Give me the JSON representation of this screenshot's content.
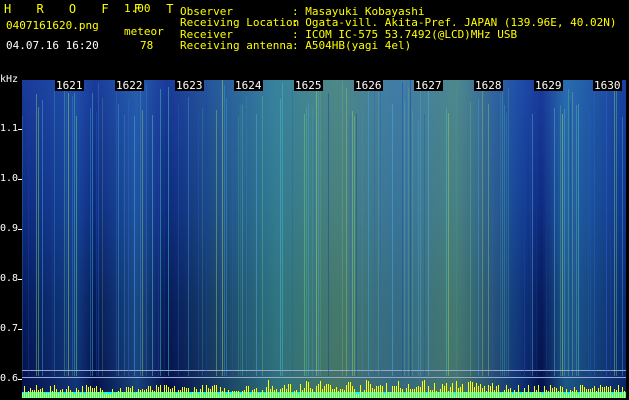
{
  "header": {
    "app_title": "H R O F F T",
    "app_version": "1.00",
    "filename": "0407161620.png",
    "meteor_label": "meteor",
    "datetime": "04.07.16 16:20",
    "meteor_count": "78"
  },
  "info": [
    {
      "label": "Observer",
      "value": ": Masayuki Kobayashi"
    },
    {
      "label": "Receiving Location",
      "value": ": Ogata-vill. Akita-Pref. JAPAN (139.96E, 40.02N)"
    },
    {
      "label": "Receiver",
      "value": ": ICOM IC-575 53.7492(@LCD)MHz USB"
    },
    {
      "label": "Receiving antenna",
      "value": ": A504HB(yagi 4el)"
    }
  ],
  "axis": {
    "unit": "kHz",
    "y_labels": [
      "1.1",
      "1.0",
      "0.9",
      "0.8",
      "0.7",
      "0.6"
    ],
    "time_labels": [
      "1621",
      "1622",
      "1623",
      "1624",
      "1625",
      "1626",
      "1627",
      "1628",
      "1629",
      "1630"
    ]
  },
  "colors": {
    "header_title": "#ffff00",
    "background": "#000000",
    "meteor_bars": "#ffff00",
    "baseline": "#00ffff"
  }
}
